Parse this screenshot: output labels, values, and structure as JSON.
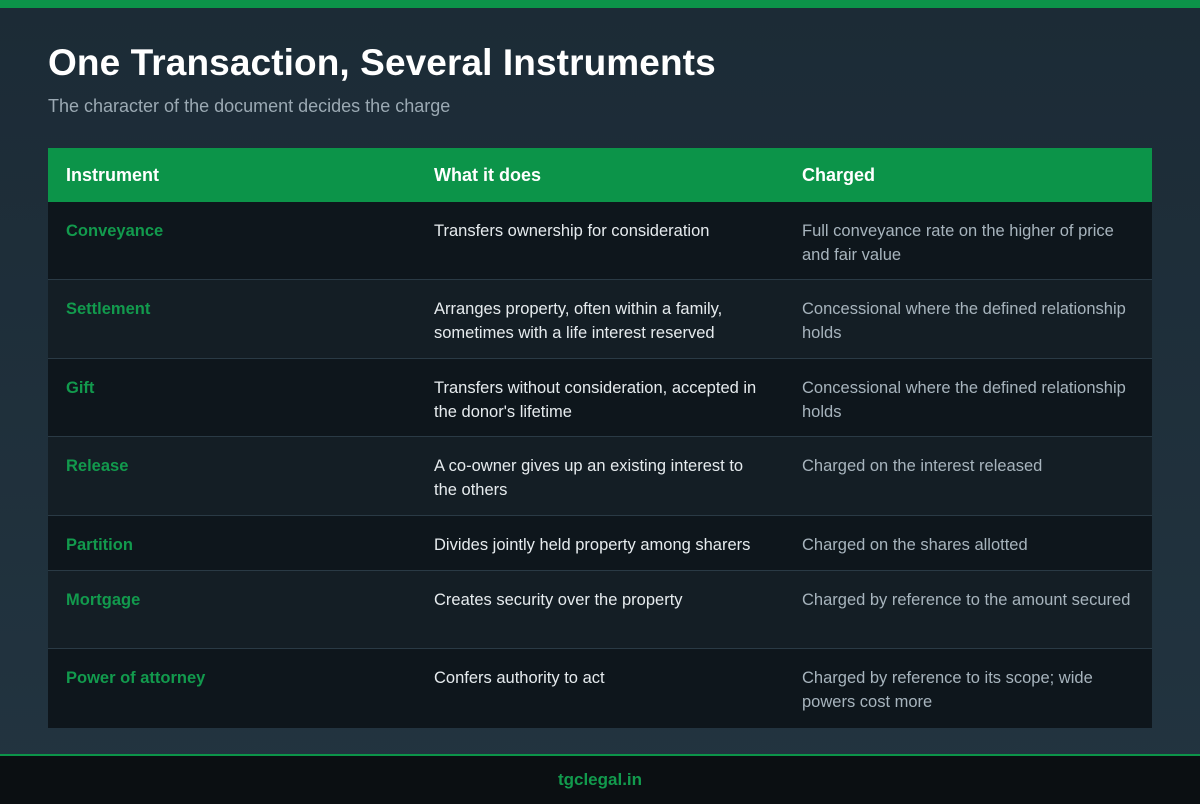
{
  "header": {
    "title": "One Transaction, Several Instruments",
    "subtitle": "The character of the document decides the charge"
  },
  "table": {
    "columns": [
      "Instrument",
      "What it does",
      "Charged"
    ],
    "rows": [
      {
        "instrument": "Conveyance",
        "does": "Transfers ownership for consideration",
        "charged": "Full conveyance rate on the higher of price and fair value"
      },
      {
        "instrument": "Settlement",
        "does": "Arranges property, often within a family, sometimes with a life interest reserved",
        "charged": "Concessional where the defined relationship holds"
      },
      {
        "instrument": "Gift",
        "does": "Transfers without consideration, accepted in the donor's lifetime",
        "charged": "Concessional where the defined relationship holds"
      },
      {
        "instrument": "Release",
        "does": "A co-owner gives up an existing interest to the others",
        "charged": "Charged on the interest released"
      },
      {
        "instrument": "Partition",
        "does": "Divides jointly held property among sharers",
        "charged": "Charged on the shares allotted"
      },
      {
        "instrument": "Mortgage",
        "does": "Creates security over the property",
        "charged": "Charged by reference to the amount secured"
      },
      {
        "instrument": "Power of attorney",
        "does": "Confers authority to act",
        "charged": "Charged by reference to its scope; wide powers cost more"
      }
    ]
  },
  "footer": {
    "site": "tgclegal.in"
  },
  "colors": {
    "accent": "#0c9449",
    "background": "#1f2f3a",
    "row_dark": "#0e161c",
    "row_light": "#141e25"
  }
}
